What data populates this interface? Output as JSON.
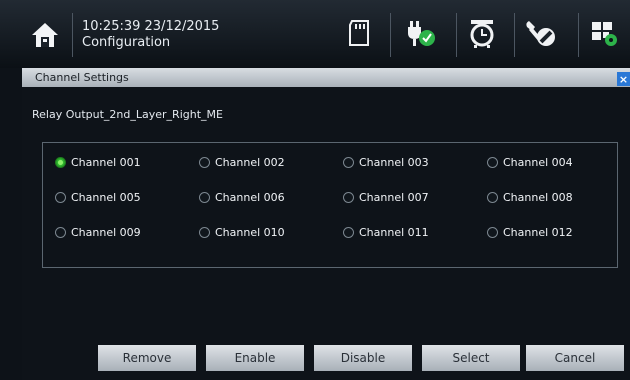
{
  "header": {
    "time": "10:25:39 23/12/2015",
    "page": "Configuration"
  },
  "toolbar_icons": [
    "sd-card-icon",
    "power-plug-ok-icon",
    "alarm-clock-icon",
    "wrench-disabled-icon",
    "grid-settings-icon"
  ],
  "dialog": {
    "title": "Channel Settings",
    "close_symbol": "×",
    "relay_label": "Relay Output_2nd_Layer_Right_ME",
    "selected_channel": "Channel 001",
    "channels": [
      "Channel 001",
      "Channel 002",
      "Channel 003",
      "Channel 004",
      "Channel 005",
      "Channel 006",
      "Channel 007",
      "Channel 008",
      "Channel 009",
      "Channel 010",
      "Channel 011",
      "Channel 012"
    ],
    "buttons": {
      "remove": "Remove",
      "enable": "Enable",
      "disable": "Disable",
      "select": "Select",
      "cancel": "Cancel"
    }
  },
  "colors": {
    "radio_selected": "#2eb82e",
    "close_button": "#2a78d6",
    "background": "#0e1319"
  }
}
